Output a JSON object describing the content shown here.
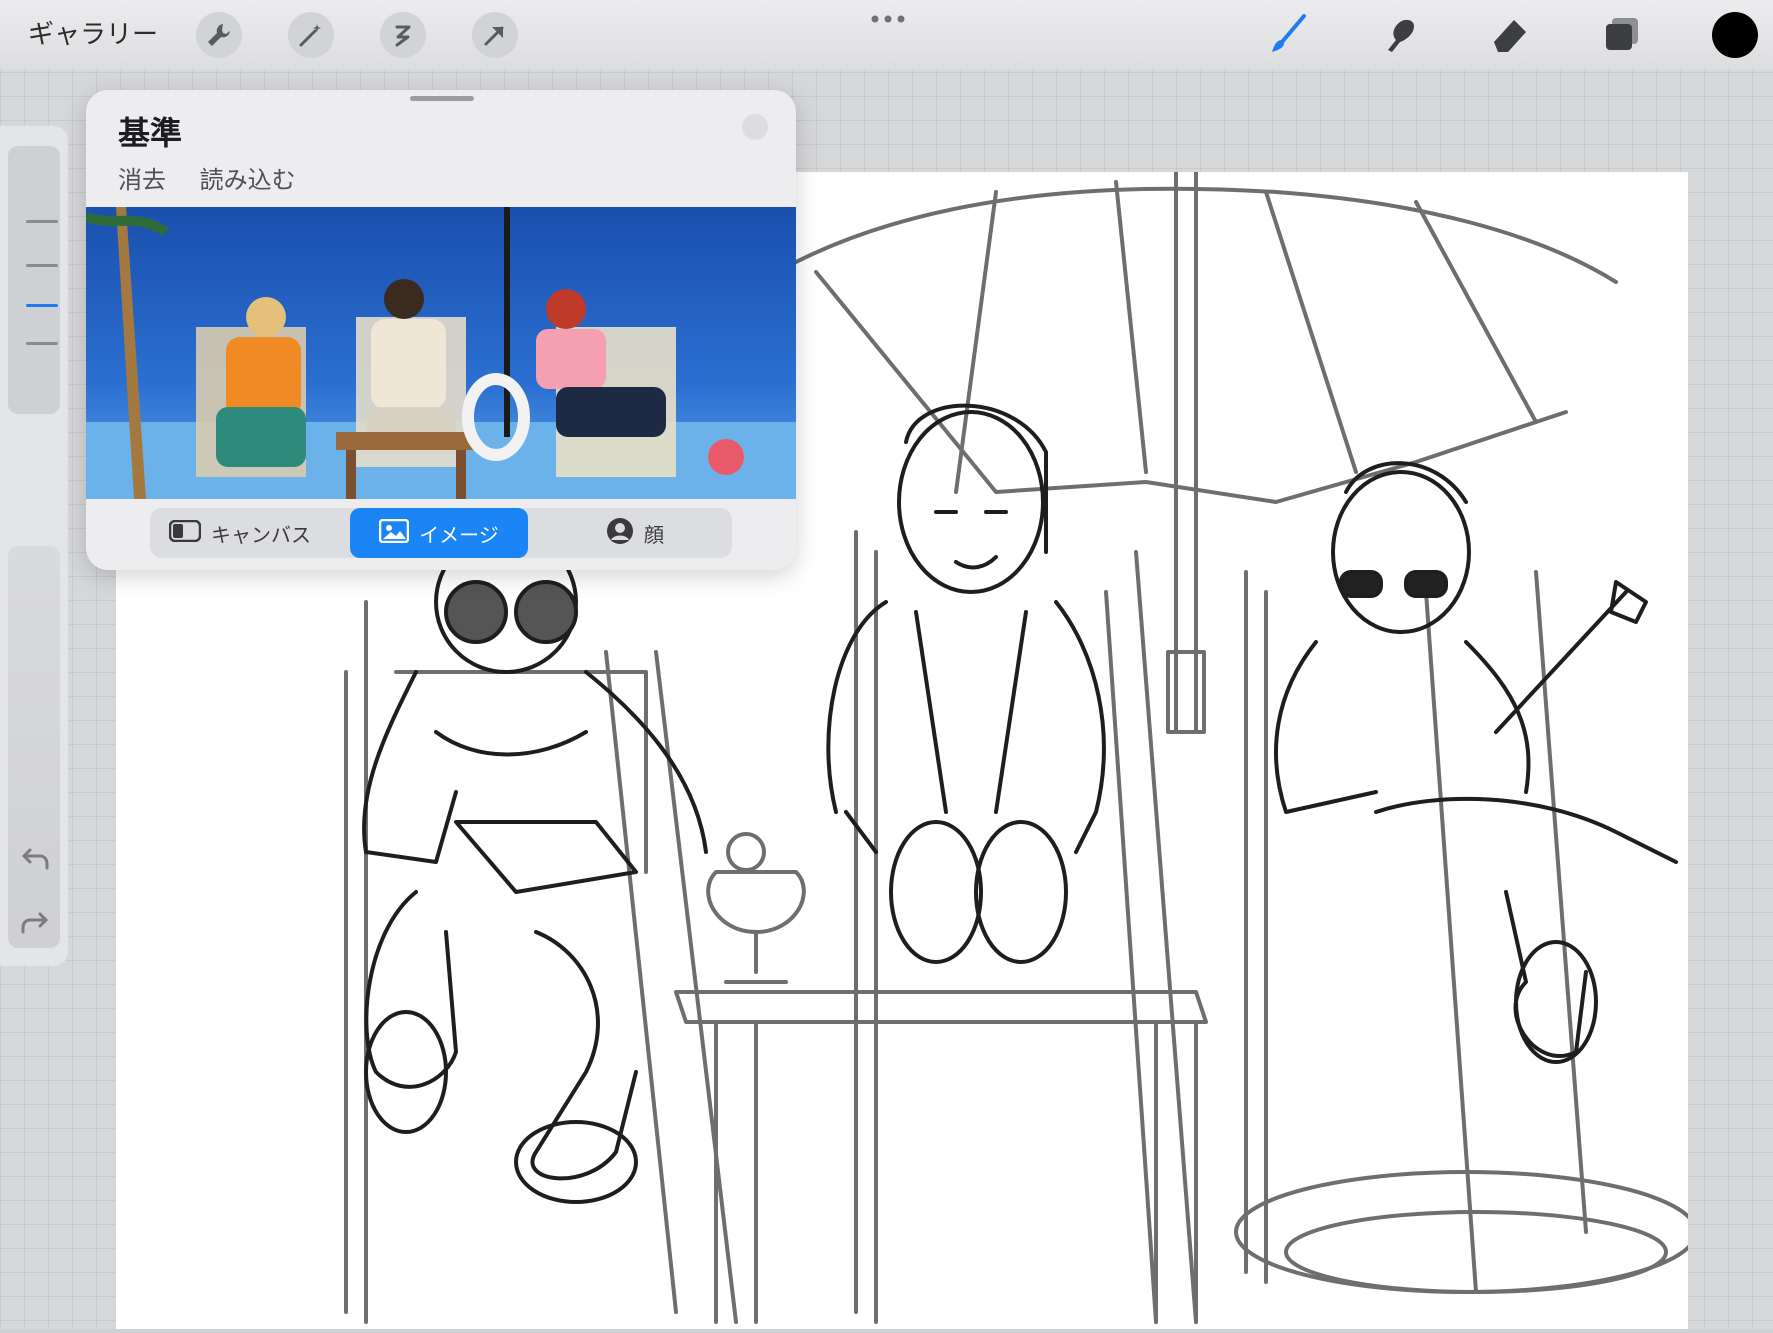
{
  "toolbar": {
    "gallery_label": "ギャラリー",
    "left_tools": [
      "wrench-icon",
      "magic-wand-icon",
      "selection-icon",
      "transform-arrow-icon"
    ],
    "right_tools": [
      "brush-icon",
      "smudge-icon",
      "eraser-icon",
      "layers-icon"
    ],
    "accent_color": "#1f7cf0",
    "current_color": "#000000"
  },
  "reference_panel": {
    "title": "基準",
    "clear_label": "消去",
    "import_label": "読み込む",
    "tabs": [
      {
        "label": "キャンバス",
        "icon": "canvas-icon",
        "selected": false
      },
      {
        "label": "イメージ",
        "icon": "image-icon",
        "selected": true
      },
      {
        "label": "顔",
        "icon": "face-icon",
        "selected": false
      }
    ]
  },
  "sidebar": {
    "brush_size_ticks": 4,
    "active_tick": 2
  }
}
